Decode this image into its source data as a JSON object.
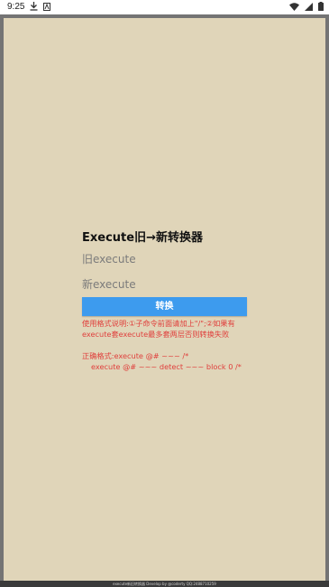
{
  "status_bar": {
    "time": "9:25",
    "icons": [
      "download-icon",
      "app-notification-icon",
      "wifi-icon",
      "signal-icon",
      "battery-icon"
    ]
  },
  "main": {
    "title": "Execute旧→新转换器",
    "old_input": {
      "value": "",
      "placeholder": "旧execute"
    },
    "new_input": {
      "value": "",
      "placeholder": "新execute"
    },
    "convert_button_label": "转换",
    "help": {
      "line1": "使用格式说明:①子命令前面请加上\"/\";②如果有",
      "line2": "execute套execute最多套两层否则转换失败",
      "line3": "正确格式:execute @# ~~~ /*",
      "line4": "execute @# ~~~ detect ~~~ block 0 /*"
    },
    "text_color": "#e0403d",
    "button_color": "#3d9bee",
    "background_color": "#e0d5b9"
  },
  "footer": {
    "text": "execute新旧转换器 Develop by @coderty QQ:2488710259"
  }
}
